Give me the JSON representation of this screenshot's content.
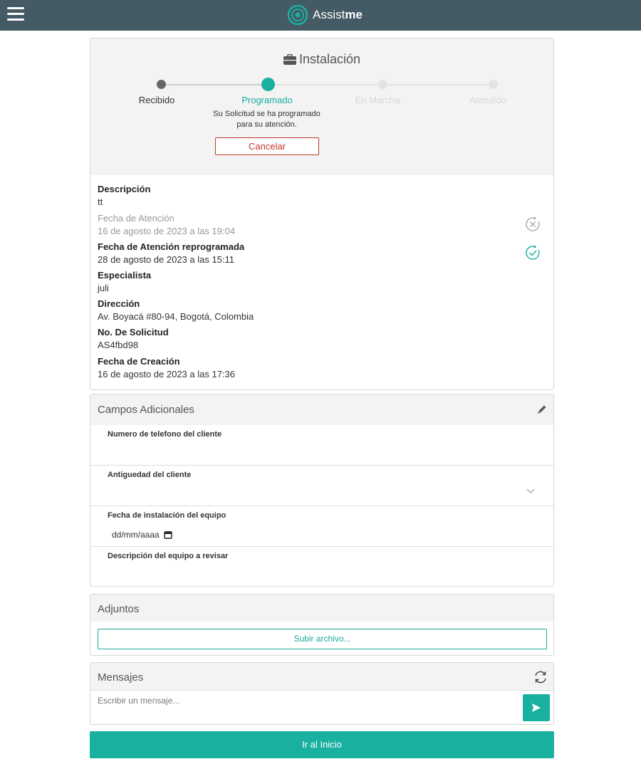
{
  "app": {
    "logo_text_light": "Assist",
    "logo_text_bold": "me"
  },
  "request": {
    "title": "Instalación",
    "steps": [
      {
        "label": "Recibido",
        "state": "done"
      },
      {
        "label": "Programado",
        "state": "current"
      },
      {
        "label": "En Marcha",
        "state": "pending"
      },
      {
        "label": "Atendido",
        "state": "pending"
      }
    ],
    "step_description": "Su Solicitud se ha programado para su atención.",
    "cancel_label": "Cancelar",
    "fields": {
      "descripcion_label": "Descripción",
      "descripcion_value": "tt",
      "fecha_atencion_label": "Fecha de Atención",
      "fecha_atencion_value": "16 de agosto de 2023 a las 19:04",
      "fecha_reprog_label": "Fecha de Atención reprogramada",
      "fecha_reprog_value": "28 de agosto de 2023 a las 15:11",
      "especialista_label": "Especialista",
      "especialista_value": "juli",
      "direccion_label": "Dirección",
      "direccion_value": "Av. Boyacá #80-94, Bogotá, Colombia",
      "solicitud_label": "No. De Solicitud",
      "solicitud_value": "AS4fbd98",
      "creacion_label": "Fecha de Creación",
      "creacion_value": "16 de agosto de 2023 a las 17:36"
    }
  },
  "extra_fields": {
    "title": "Campos Adicionales",
    "rows": [
      {
        "label": "Numero de telefono del cliente"
      },
      {
        "label": "Antiguedad del cliente"
      },
      {
        "label": "Fecha de instalación del equipo",
        "placeholder": "dd/mm/aaaa"
      },
      {
        "label": "Descripción del equipo a revisar"
      }
    ]
  },
  "attachments": {
    "title": "Adjuntos",
    "upload_label": "Subir archivo..."
  },
  "messages": {
    "title": "Mensajes",
    "placeholder": "Escribir un mensaje..."
  },
  "footer": {
    "home_label": "Ir al Inicio"
  },
  "colors": {
    "accent": "#1ab0a0",
    "topbar": "#445a64",
    "danger": "#c0392b"
  }
}
